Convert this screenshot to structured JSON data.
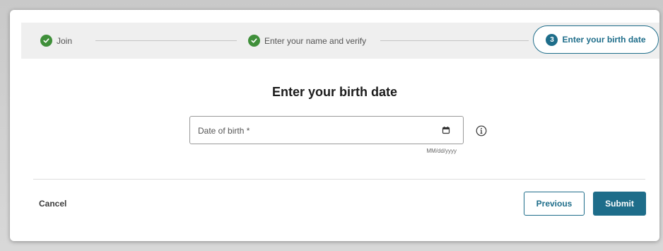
{
  "stepper": {
    "steps": [
      {
        "label": "Join",
        "status": "complete"
      },
      {
        "label": "Enter your name and verify",
        "status": "complete"
      },
      {
        "label": "Enter your birth date",
        "status": "current",
        "number": "3"
      }
    ]
  },
  "form": {
    "title": "Enter your birth date",
    "dob_label": "Date of birth *",
    "dob_hint": "MM/dd/yyyy"
  },
  "actions": {
    "cancel_label": "Cancel",
    "previous_label": "Previous",
    "submit_label": "Submit"
  },
  "colors": {
    "accent": "#1e6d8a",
    "complete": "#3f8f3a"
  },
  "icons": [
    "check-icon",
    "calendar-icon",
    "info-icon"
  ]
}
